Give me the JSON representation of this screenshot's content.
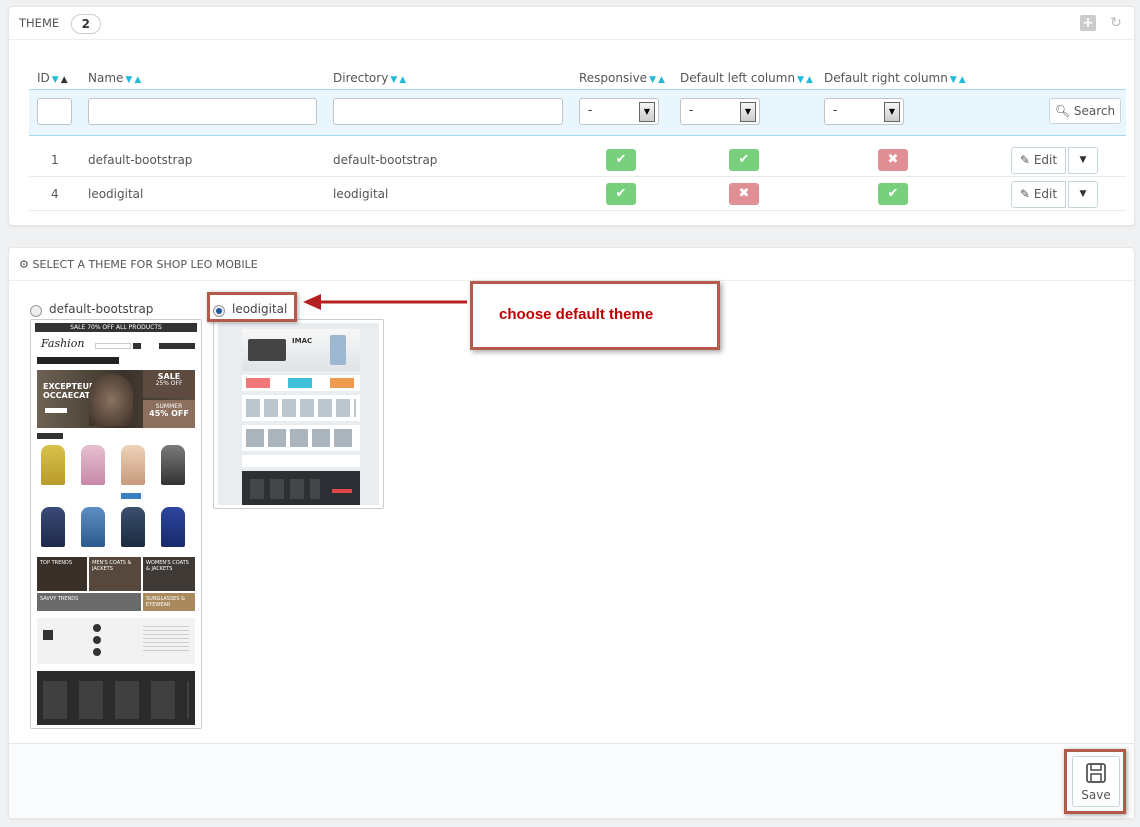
{
  "theme_panel": {
    "title": "THEME",
    "count": "2",
    "columns": {
      "id": "ID",
      "name": "Name",
      "directory": "Directory",
      "responsive": "Responsive",
      "left_col": "Default left column",
      "right_col": "Default right column"
    },
    "filters": {
      "responsive": "-",
      "left_col": "-",
      "right_col": "-"
    },
    "search_label": "Search",
    "edit_label": "Edit",
    "rows": [
      {
        "id": "1",
        "name": "default-bootstrap",
        "directory": "default-bootstrap",
        "responsive": true,
        "left_col": true,
        "right_col": false
      },
      {
        "id": "4",
        "name": "leodigital",
        "directory": "leodigital",
        "responsive": true,
        "left_col": false,
        "right_col": true
      }
    ]
  },
  "select_panel": {
    "title": "SELECT A THEME FOR SHOP LEO MOBILE",
    "options": [
      {
        "label": "default-bootstrap",
        "checked": false
      },
      {
        "label": "leodigital",
        "checked": true
      }
    ],
    "callout": "choose default theme",
    "save_label": "Save"
  },
  "thumb_fashion": {
    "banner": "SALE 70% OFF ALL PRODUCTS",
    "logo": "Fashion",
    "hero_line1": "EXCEPTEUR",
    "hero_line2": "OCCAECAT",
    "sale_top": "SALE",
    "sale_top_pct": "25% OFF",
    "sale_bottom": "SUMMER",
    "sale_bottom_pct": "45% OFF",
    "tile1": "TOP TRENDS",
    "tile2": "MEN'S COATS & JACKETS",
    "tile3": "WOMEN'S COATS & JACKETS",
    "tile4": "SAVVY TRENDS",
    "tile5": "SUNGLASSES & EYEWEAR"
  },
  "thumb_digital": {
    "hero": "IMAC"
  }
}
